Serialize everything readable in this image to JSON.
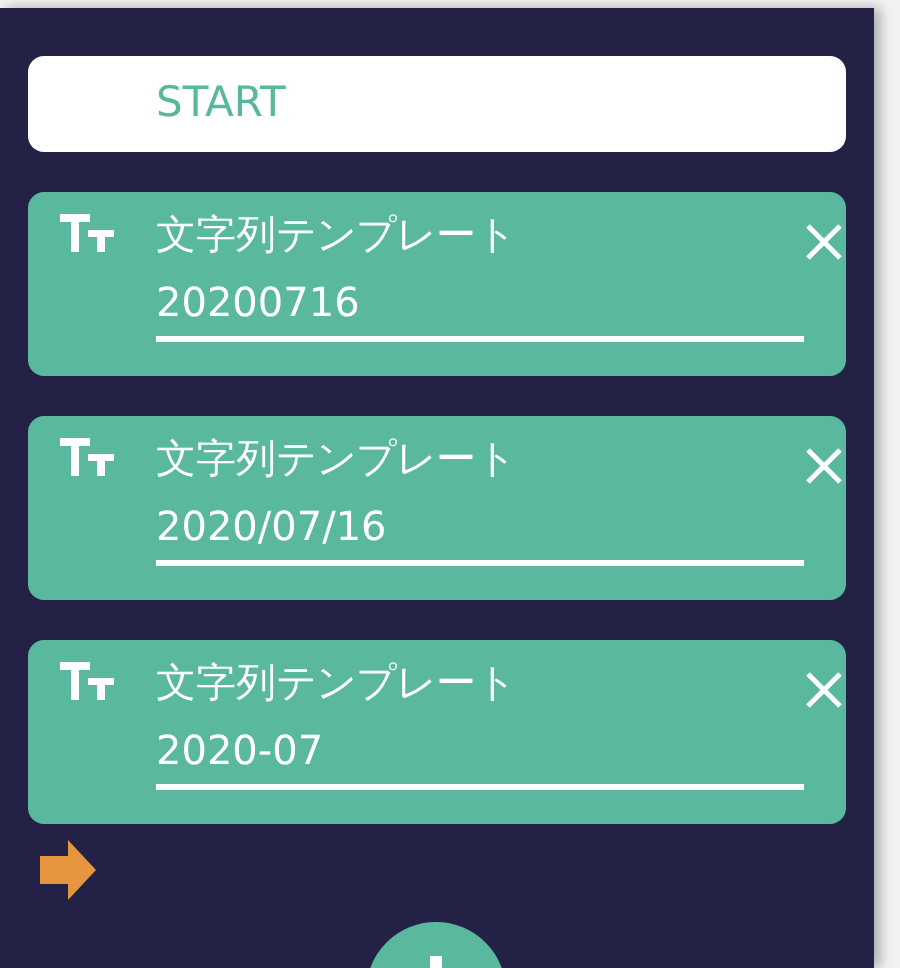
{
  "start_label": "START",
  "templates": [
    {
      "title": "文字列テンプレート",
      "value": "20200716"
    },
    {
      "title": "文字列テンプレート",
      "value": "2020/07/16"
    },
    {
      "title": "文字列テンプレート",
      "value": "2020-07"
    }
  ]
}
